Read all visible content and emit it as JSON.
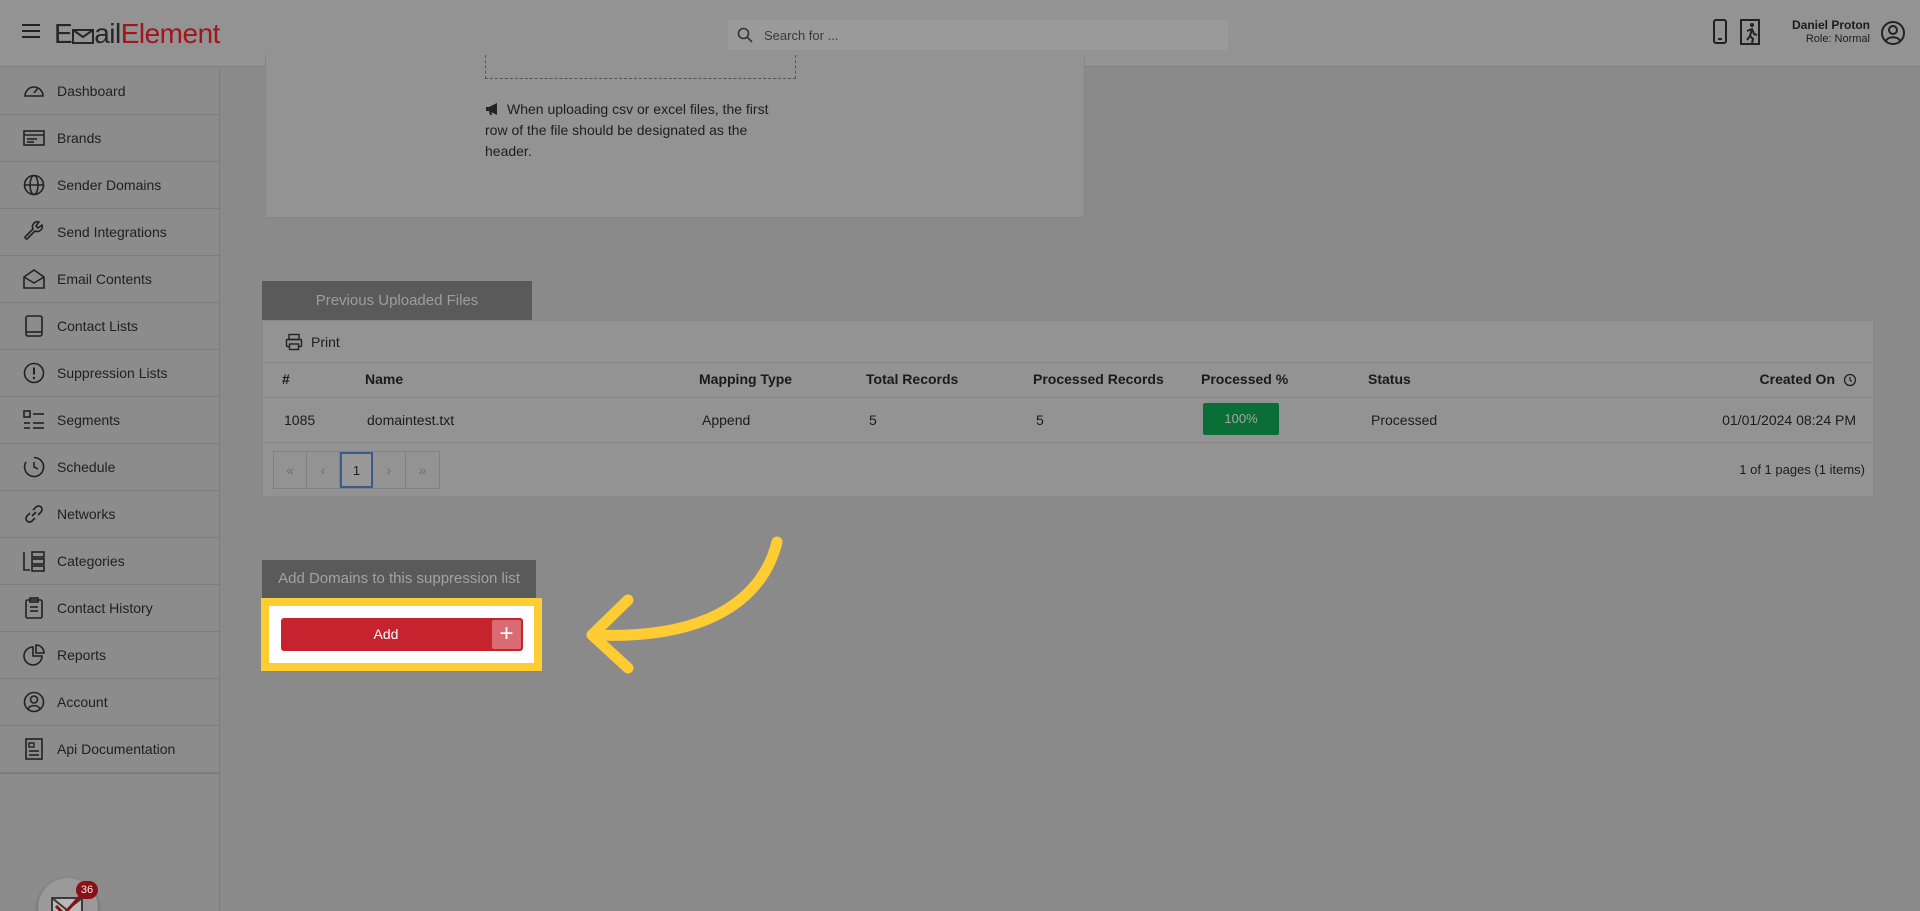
{
  "header": {
    "logo_part1": "E",
    "logo_part2": "ail",
    "logo_part3": "Element",
    "search_placeholder": "Search for ...",
    "user_name": "Daniel Proton",
    "user_role": "Role: Normal"
  },
  "sidebar": {
    "items": [
      {
        "label": "Dashboard",
        "icon": "dashboard-icon"
      },
      {
        "label": "Brands",
        "icon": "brands-icon"
      },
      {
        "label": "Sender Domains",
        "icon": "globe-icon"
      },
      {
        "label": "Send Integrations",
        "icon": "wrench-icon"
      },
      {
        "label": "Email Contents",
        "icon": "envelope-open-icon"
      },
      {
        "label": "Contact Lists",
        "icon": "book-icon"
      },
      {
        "label": "Suppression Lists",
        "icon": "exclamation-circle-icon"
      },
      {
        "label": "Segments",
        "icon": "list-icon"
      },
      {
        "label": "Schedule",
        "icon": "clock-history-icon"
      },
      {
        "label": "Networks",
        "icon": "link-icon"
      },
      {
        "label": "Categories",
        "icon": "categories-icon"
      },
      {
        "label": "Contact History",
        "icon": "clipboard-icon"
      },
      {
        "label": "Reports",
        "icon": "pie-chart-icon"
      },
      {
        "label": "Account",
        "icon": "user-circle-icon"
      },
      {
        "label": "Api Documentation",
        "icon": "document-icon"
      }
    ],
    "notification_count": "36"
  },
  "upload_card": {
    "info_text": "When uploading csv or excel files, the first row of the file should be designated as the header."
  },
  "files": {
    "tab_label": "Previous Uploaded Files",
    "print_label": "Print",
    "columns": {
      "num": "#",
      "name": "Name",
      "mapping": "Mapping Type",
      "total": "Total Records",
      "processed": "Processed Records",
      "pct": "Processed %",
      "status": "Status",
      "created": "Created On"
    },
    "rows": [
      {
        "num": "1085",
        "name": "domaintest.txt",
        "mapping": "Append",
        "total": "5",
        "processed": "5",
        "pct": "100%",
        "status": "Processed",
        "created": "01/01/2024 08:24 PM"
      }
    ],
    "pager": {
      "first": "«",
      "prev": "‹",
      "current": "1",
      "next": "›",
      "last": "»",
      "info": "1 of 1 pages (1 items)"
    }
  },
  "add_section": {
    "tab_label": "Add Domains to this suppression list",
    "add_label": "Add",
    "plus": "+"
  },
  "colors": {
    "brand_red": "#c6232e",
    "highlight": "#ffcc33",
    "success": "#0a6f36"
  }
}
